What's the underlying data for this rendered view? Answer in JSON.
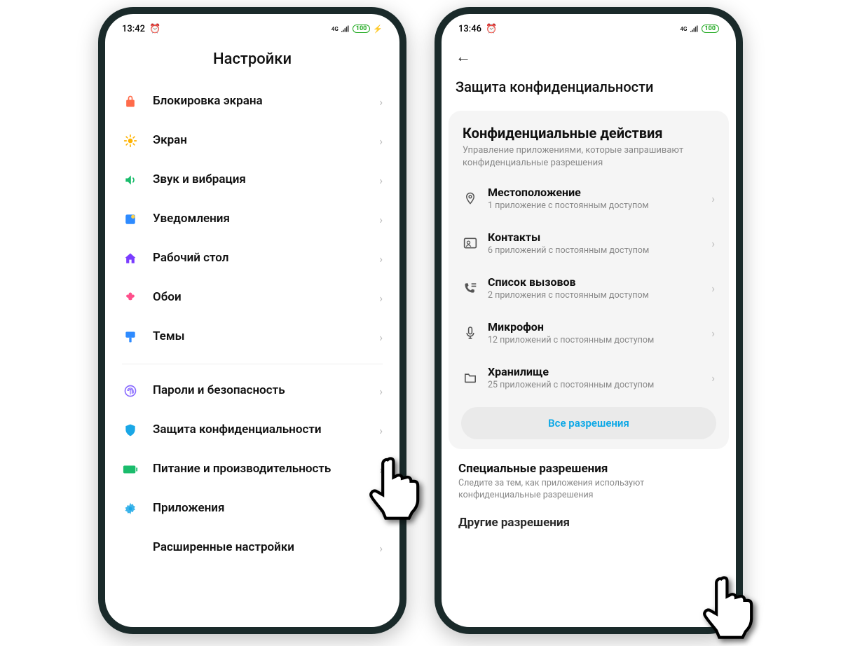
{
  "phone1": {
    "status": {
      "time": "13:42",
      "net": "4G",
      "battery": "100"
    },
    "title": "Настройки",
    "items": [
      {
        "label": "Блокировка экрана"
      },
      {
        "label": "Экран"
      },
      {
        "label": "Звук и вибрация"
      },
      {
        "label": "Уведомления"
      },
      {
        "label": "Рабочий стол"
      },
      {
        "label": "Обои"
      },
      {
        "label": "Темы"
      }
    ],
    "items2": [
      {
        "label": "Пароли и безопасность"
      },
      {
        "label": "Защита конфиденциальности"
      },
      {
        "label": "Питание и производительность"
      },
      {
        "label": "Приложения"
      },
      {
        "label": "Расширенные настройки"
      }
    ]
  },
  "phone2": {
    "status": {
      "time": "13:46",
      "net": "4G",
      "battery": "100"
    },
    "title": "Защита конфиденциальности",
    "card": {
      "title": "Конфиденциальные действия",
      "sub": "Управление приложениями, которые запрашивают конфиденциальные разрешения",
      "perms": [
        {
          "label": "Местоположение",
          "sub": "1 приложение с постоянным доступом"
        },
        {
          "label": "Контакты",
          "sub": "6 приложений с постоянным доступом"
        },
        {
          "label": "Список вызовов",
          "sub": "2 приложения с постоянным доступом"
        },
        {
          "label": "Микрофон",
          "sub": "12 приложений с постоянным доступом"
        },
        {
          "label": "Хранилище",
          "sub": "25 приложений с постоянным доступом"
        }
      ],
      "all": "Все разрешения"
    },
    "special": {
      "title": "Специальные разрешения",
      "sub": "Следите за тем, как приложения используют конфиденциальные разрешения"
    },
    "cutoff": "Другие разрешения"
  }
}
